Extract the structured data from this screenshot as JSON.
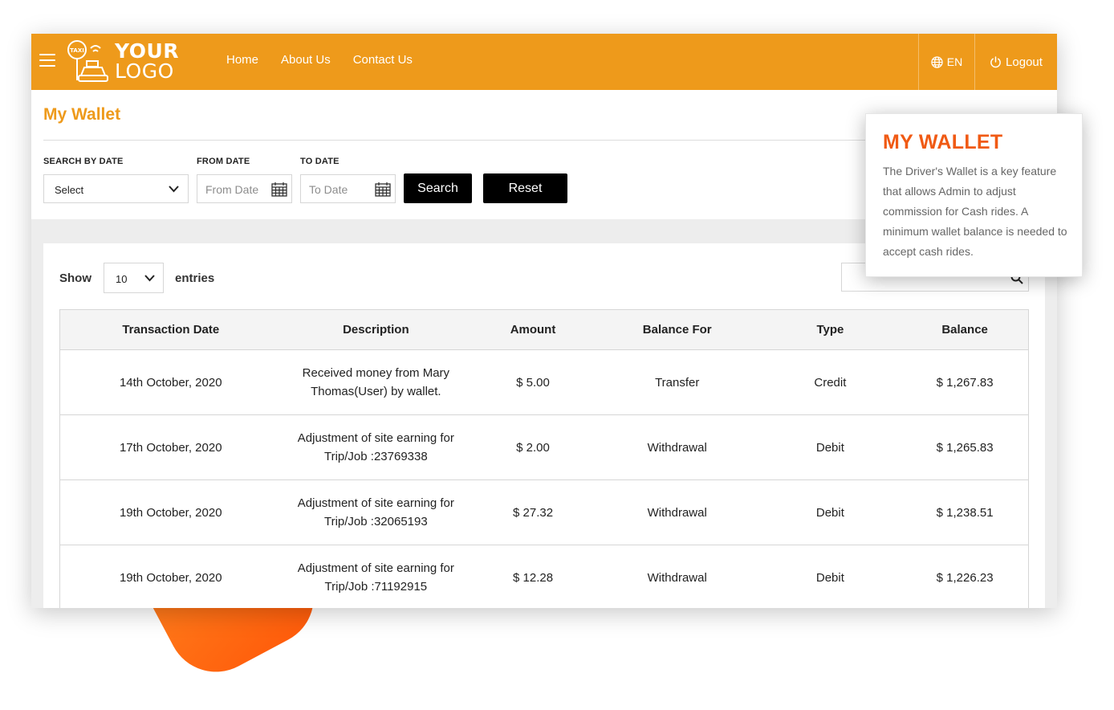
{
  "header": {
    "logo": {
      "line1": "YOUR",
      "line2": "LOGO",
      "sign": "TAXI"
    },
    "nav": [
      {
        "label": "Home"
      },
      {
        "label": "About Us"
      },
      {
        "label": "Contact Us"
      }
    ],
    "language": "EN",
    "logout_label": "Logout"
  },
  "page": {
    "title": "My Wallet"
  },
  "filters": {
    "search_by_date": {
      "label": "SEARCH BY DATE",
      "value": "Select"
    },
    "from_date": {
      "label": "FROM DATE",
      "placeholder": "From Date"
    },
    "to_date": {
      "label": "TO DATE",
      "placeholder": "To Date"
    },
    "search_button": "Search",
    "reset_button": "Reset"
  },
  "table_controls": {
    "show_label": "Show",
    "entries_value": "10",
    "entries_label": "entries"
  },
  "table": {
    "columns": [
      "Transaction Date",
      "Description",
      "Amount",
      "Balance For",
      "Type",
      "Balance"
    ],
    "rows": [
      [
        "14th October, 2020",
        "Received money from Mary Thomas(User) by wallet.",
        "$ 5.00",
        "Transfer",
        "Credit",
        "$ 1,267.83"
      ],
      [
        "17th October, 2020",
        "Adjustment of site earning for Trip/Job :23769338",
        "$ 2.00",
        "Withdrawal",
        "Debit",
        "$ 1,265.83"
      ],
      [
        "19th October, 2020",
        "Adjustment of site earning for Trip/Job :32065193",
        "$ 27.32",
        "Withdrawal",
        "Debit",
        "$ 1,238.51"
      ],
      [
        "19th October, 2020",
        "Adjustment of site earning for Trip/Job :71192915",
        "$ 12.28",
        "Withdrawal",
        "Debit",
        "$ 1,226.23"
      ]
    ]
  },
  "tooltip": {
    "title": "MY WALLET",
    "body": "The Driver's Wallet is a key feature that allows Admin to adjust commission for Cash rides. A minimum wallet balance is needed to accept cash rides."
  },
  "colors": {
    "header_bg": "#ee9a1b",
    "title_color": "#ee9a1b",
    "tooltip_title": "#f05a14",
    "button_bg": "#000000"
  },
  "icons": [
    "hamburger-icon",
    "taxi-logo-icon",
    "globe-icon",
    "power-icon",
    "chevron-down-icon",
    "calendar-icon",
    "search-icon"
  ]
}
